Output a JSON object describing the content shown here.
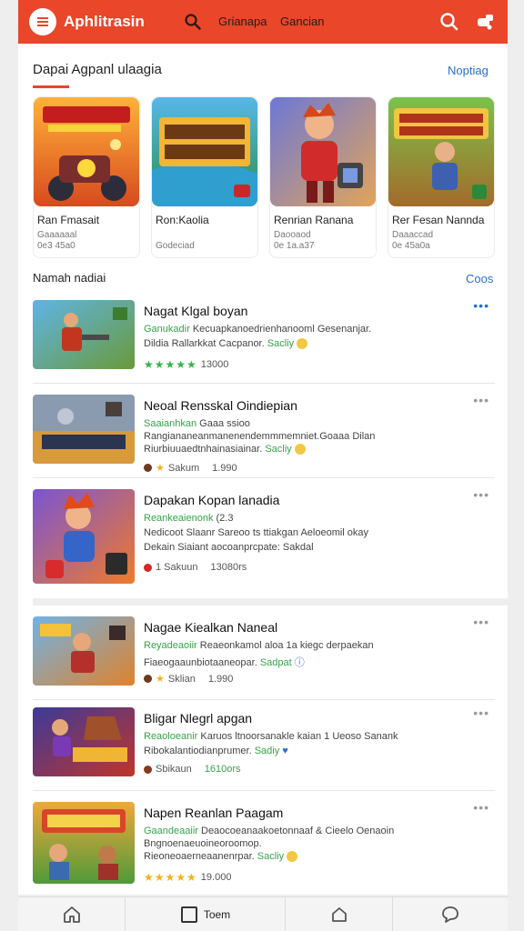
{
  "header": {
    "title": "Aphlitrasin",
    "links": [
      "Grianapa",
      "Gancian"
    ],
    "bg_color": "#e9462a"
  },
  "featured": {
    "title": "Dapai Agpanl ulaagia",
    "action": "Noptiag",
    "cards": [
      {
        "title": "Ran Fmasait",
        "line1": "Gaaaaaal",
        "line2": "0e3 45a0",
        "palette": "red"
      },
      {
        "title": "Ron:Kaolia",
        "line1": "",
        "line2": "Godeciad",
        "palette": "river"
      },
      {
        "title": "Renrian Ranana",
        "line1": "Daooaod",
        "line2": "0e 1a.a37",
        "palette": "hero"
      },
      {
        "title": "Rer Fesan Nannda",
        "line1": "Daaaccad",
        "line2": "0e 45a0a",
        "palette": "green"
      }
    ]
  },
  "recent": {
    "title": "Namah nadiai",
    "action": "Coos",
    "items": [
      {
        "title": "Nagat Klgal boyan",
        "category": "Ganukadir",
        "category_rest": "Kecuapkanoedrienhanooml Gesenanjar.",
        "desc1": "Dildia Rallarkkat Cacpanor.",
        "desc2": "",
        "highlight": "Sacliy",
        "rating_kind": "stars-green",
        "rating_text": "★★★★★",
        "count": "13000",
        "more": "•••"
      },
      {
        "title": "Neoal Rensskal Oindiepian",
        "category": "Saaianhkan",
        "category_rest": "Gaaa ssioo",
        "desc1": "Rangiananeanmanenendemmmemniet.Goaaa Dilan",
        "desc2": "Riurbiuuaedtnhainasiainar.",
        "highlight": "Sacliy",
        "rating_kind": "dot-star",
        "rating_text": "Sakum",
        "count": "1.990",
        "more": "•••"
      },
      {
        "title": "Dapakan Kopan lanadia",
        "category": "Reankeaienonk",
        "category_rest": "(2.3",
        "desc1": "Nedicoot Slaanr Sareoo ts ttiakgan Aeloeomil okay",
        "desc2": "Dekain Siaiant aocoanprcpate: Sakdal",
        "highlight": "",
        "rating_kind": "dot",
        "rating_text": "1 Sakuun",
        "count": "13080rs",
        "more": "•••"
      },
      {
        "title": "Nagae Kiealkan Naneal",
        "category": "Reyadeaoiir",
        "category_rest": "Reaeonkamol aloa 1a kiegc derpaekan",
        "desc1": "Fiaeogaaunbiotaaneopar.",
        "desc2": "",
        "highlight": "Sadpat",
        "rating_kind": "dot-star",
        "rating_text": "Sklian",
        "count": "1.990",
        "more": "•••"
      },
      {
        "title": "Bligar Nlegrl apgan",
        "category": "Reaoloeanir",
        "category_rest": "Karuos ltnoorsanakle kaian 1 Ueoso Sanank",
        "desc1": "Ribokalantiodianprumer.",
        "desc2": "",
        "highlight": "Sadiy",
        "rating_kind": "dot",
        "rating_text": "Sbikaun",
        "count": "1610ors",
        "more": "•••"
      },
      {
        "title": "Napen Reanlan Paagam",
        "category": "Gaandeaaiir",
        "category_rest": "Deaocoeanaakoetonnaaf & Cieelo Oenaoin",
        "desc1": "Bngnoenaeuoineoroomop.",
        "desc2": "Rieoneoaerneaanenrpar.",
        "highlight": "Sacliy",
        "rating_kind": "stars-gold",
        "rating_text": "★★★★★",
        "count": "19.000",
        "more": "•••"
      }
    ]
  },
  "bottom_nav": {
    "label": "Toem"
  }
}
